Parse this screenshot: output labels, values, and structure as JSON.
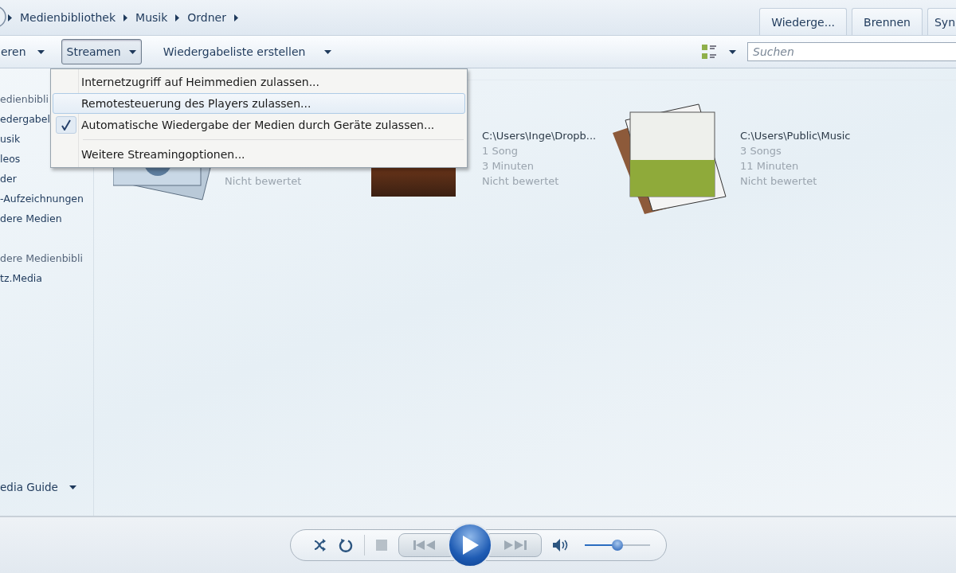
{
  "breadcrumb": [
    "Medienbibliothek",
    "Musik",
    "Ordner"
  ],
  "tabs": [
    "Wiederge...",
    "Brennen",
    "Syn"
  ],
  "toolbar": {
    "buttons": [
      {
        "label": "eren",
        "pressed": false
      },
      {
        "label": "Streamen",
        "pressed": true
      },
      {
        "label": "Wiedergabeliste erstellen",
        "pressed": false
      }
    ]
  },
  "search": {
    "placeholder": "Suchen"
  },
  "sidebar": {
    "items": [
      {
        "label": "edienbibli",
        "kind": "header"
      },
      {
        "label": "edergabel",
        "kind": "item"
      },
      {
        "label": "usik",
        "kind": "item"
      },
      {
        "label": "leos",
        "kind": "item"
      },
      {
        "label": "der",
        "kind": "item"
      },
      {
        "label": "-Aufzeichnungen",
        "kind": "item"
      },
      {
        "label": "dere Medien",
        "kind": "item"
      },
      {
        "label": "dere Medienbibli",
        "kind": "header"
      },
      {
        "label": "tz.Media",
        "kind": "item"
      }
    ],
    "footer": "edia Guide"
  },
  "albums": [
    {
      "kind": "stack",
      "lines": [
        "Nicht bewertet"
      ]
    },
    {
      "kind": "photo",
      "lines": [
        "C:\\Users\\Inge\\Dropb...",
        "1 Song",
        "3 Minuten",
        "Nicht bewertet"
      ]
    },
    {
      "kind": "covers",
      "lines": [
        "C:\\Users\\Public\\Music",
        "3 Songs",
        "11 Minuten",
        "Nicht bewertet"
      ]
    }
  ],
  "menu": [
    {
      "kind": "option",
      "label": "Internetzugriff auf Heimmedien zulassen...",
      "checked": false,
      "highlighted": false
    },
    {
      "kind": "option",
      "label": "Remotesteuerung des Players zulassen...",
      "checked": false,
      "highlighted": true
    },
    {
      "kind": "option",
      "label": "Automatische Wiedergabe der Medien durch Geräte zulassen...",
      "checked": true,
      "highlighted": false
    },
    {
      "kind": "separator"
    },
    {
      "kind": "option",
      "label": "Weitere Streamingoptionen...",
      "checked": false,
      "highlighted": false
    }
  ],
  "player": {
    "volume": {
      "level": 0.5
    }
  }
}
